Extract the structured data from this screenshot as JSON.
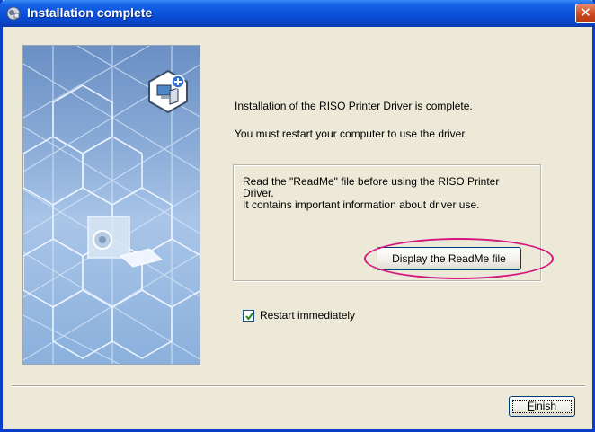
{
  "window": {
    "title": "Installation complete",
    "close_glyph": "✕",
    "title_icon": "installer-icon"
  },
  "content": {
    "line1": "Installation of the RISO Printer Driver is complete.",
    "line2": "You must restart your computer to use the driver."
  },
  "readme_group": {
    "text1": "Read the \"ReadMe\" file before using the RISO Printer Driver.",
    "text2": "It contains important information about driver use.",
    "button_label": "Display the ReadMe file"
  },
  "restart": {
    "label": "Restart immediately",
    "checked": true
  },
  "footer": {
    "finish_label": "Finish"
  },
  "colors": {
    "title_bar": "#0a4fd8",
    "dialog_bg": "#ece9d8",
    "highlight": "#d6157f"
  }
}
